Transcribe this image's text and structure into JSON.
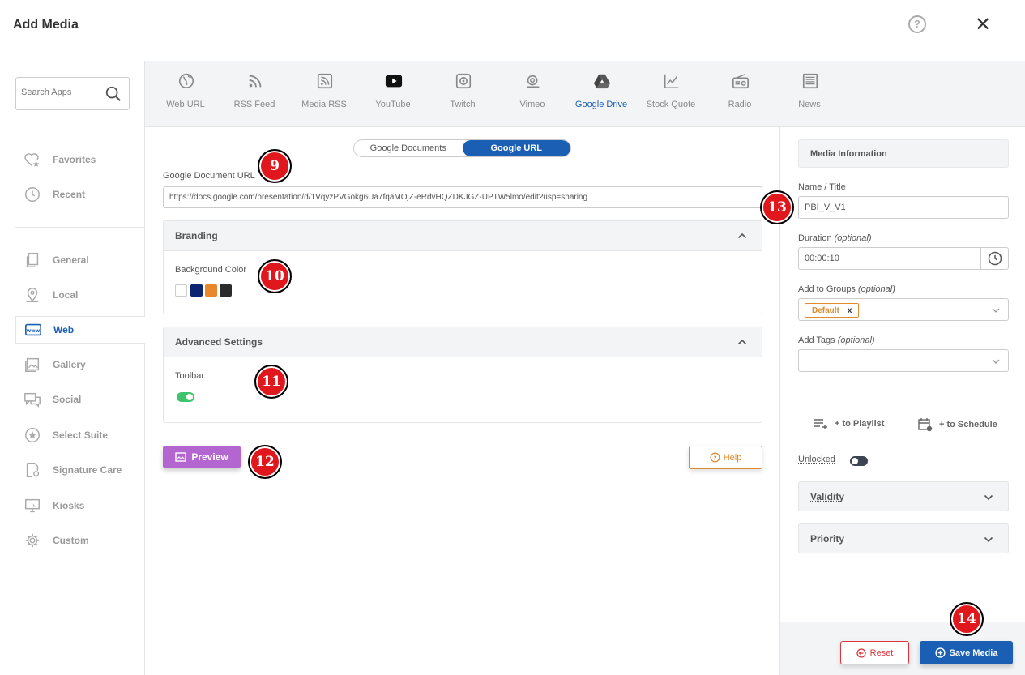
{
  "header": {
    "title": "Add Media",
    "help_glyph": "?",
    "close_glyph": "✕"
  },
  "search": {
    "placeholder": "Search Apps"
  },
  "sidebar": {
    "items": [
      {
        "label": "Favorites",
        "icon": "heart-star-icon"
      },
      {
        "label": "Recent",
        "icon": "clock-icon"
      },
      {
        "label": "General",
        "icon": "copy-icon"
      },
      {
        "label": "Local",
        "icon": "map-pin-icon"
      },
      {
        "label": "Web",
        "icon": "www-icon",
        "active": true
      },
      {
        "label": "Gallery",
        "icon": "image-icon"
      },
      {
        "label": "Social",
        "icon": "chat-icon"
      },
      {
        "label": "Select Suite",
        "icon": "star-circle-icon"
      },
      {
        "label": "Signature Care",
        "icon": "document-pin-icon"
      },
      {
        "label": "Kiosks",
        "icon": "kiosk-icon"
      },
      {
        "label": "Custom",
        "icon": "gear-icon"
      }
    ]
  },
  "apps": [
    {
      "label": "Web URL",
      "icon": "globe-icon"
    },
    {
      "label": "RSS Feed",
      "icon": "rss-icon"
    },
    {
      "label": "Media RSS",
      "icon": "media-rss-icon"
    },
    {
      "label": "YouTube",
      "icon": "youtube-icon"
    },
    {
      "label": "Twitch",
      "icon": "twitch-icon"
    },
    {
      "label": "Vimeo",
      "icon": "vimeo-icon"
    },
    {
      "label": "Google Drive",
      "icon": "google-drive-icon",
      "active": true
    },
    {
      "label": "Stock Quote",
      "icon": "chart-icon"
    },
    {
      "label": "Radio",
      "icon": "radio-icon"
    },
    {
      "label": "News",
      "icon": "news-icon"
    }
  ],
  "source_toggle": {
    "option1": "Google Documents",
    "option2": "Google URL",
    "selected": "Google URL"
  },
  "url_field": {
    "label": "Google Document URL",
    "value": "https://docs.google.com/presentation/d/1VqyzPVGokg6Ua7fqaMOjZ-eRdvHQZDKJGZ-UPTW5lmo/edit?usp=sharing"
  },
  "branding": {
    "title": "Branding",
    "bg_label": "Background Color",
    "swatches": [
      "#ffffff",
      "#0d2470",
      "#e9872d",
      "#2b2b2b"
    ]
  },
  "advanced": {
    "title": "Advanced Settings",
    "toolbar_label": "Toolbar",
    "toolbar_on": true
  },
  "buttons": {
    "preview": "Preview",
    "help": "Help"
  },
  "info": {
    "title": "Media Information",
    "name_label": "Name / Title",
    "name_value": "PBI_V_V1",
    "duration_label": "Duration",
    "duration_opt": "(optional)",
    "duration_value": "00:00:10",
    "groups_label": "Add to Groups",
    "groups_opt": "(optional)",
    "group_tag": "Default",
    "group_tag_remove": "x",
    "tags_label": "Add Tags",
    "tags_opt": "(optional)",
    "playlist": "+ to Playlist",
    "schedule": "+ to Schedule",
    "unlocked": "Unlocked",
    "unlocked_on": false,
    "validity": "Validity",
    "priority": "Priority"
  },
  "footer": {
    "reset": "Reset",
    "save": "Save Media"
  },
  "badges": {
    "b9": "9",
    "b10": "10",
    "b11": "11",
    "b12": "12",
    "b13": "13",
    "b14": "14"
  },
  "colors": {
    "accent": "#1a5fb4",
    "preview": "#b366cf",
    "help": "#e08a2c",
    "reset": "#d9363e",
    "badge": "#e0171c",
    "toggle_on": "#3ec46d"
  }
}
